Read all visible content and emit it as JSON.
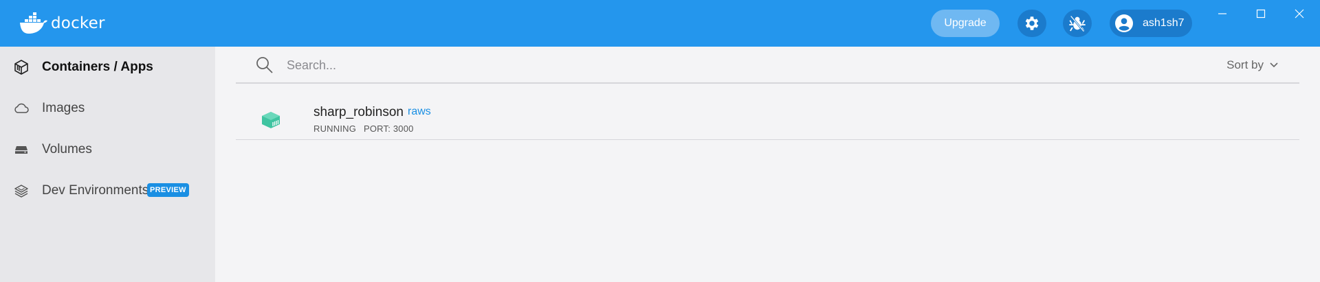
{
  "header": {
    "brand": "docker",
    "upgrade_label": "Upgrade",
    "user_name": "ash1sh7",
    "icons": {
      "logo": "docker-whale-icon",
      "settings": "gear-icon",
      "bug": "bug-icon",
      "user": "user-avatar-icon"
    },
    "window_controls": [
      "minimize-icon",
      "maximize-icon",
      "close-icon"
    ],
    "colors": {
      "header_bg": "#2496ed",
      "button_bg": "#1b7bcc",
      "upgrade_bg": "#6fb8f2"
    }
  },
  "sidebar": {
    "items": [
      {
        "label": "Containers / Apps",
        "icon": "container-box-icon",
        "active": true
      },
      {
        "label": "Images",
        "icon": "cloud-icon",
        "active": false
      },
      {
        "label": "Volumes",
        "icon": "hard-drive-icon",
        "active": false
      },
      {
        "label": "Dev Environments",
        "icon": "layers-icon",
        "active": false,
        "badge": "PREVIEW"
      }
    ]
  },
  "main": {
    "search": {
      "placeholder": "Search...",
      "value": ""
    },
    "sort_label": "Sort by",
    "containers": [
      {
        "name": "sharp_robinson",
        "image": "raws",
        "status": "RUNNING",
        "port": "PORT: 3000",
        "icon": "container-running-icon",
        "status_color": "#3fc4a1"
      }
    ]
  }
}
